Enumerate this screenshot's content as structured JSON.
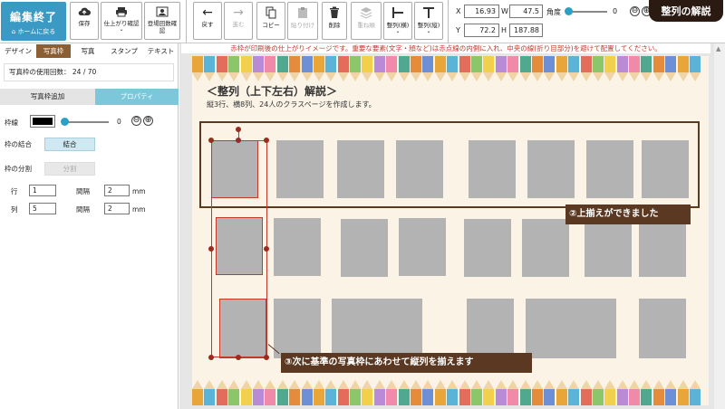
{
  "toolbar": {
    "finish_label": "編集終了",
    "home_label": "ホームに戻る",
    "buttons": {
      "save": "保存",
      "print_check": "仕上がり確認",
      "appearance_count": "登場回数確認",
      "back": "戻す",
      "forward": "進む",
      "copy": "コピー",
      "paste": "貼り付け",
      "delete": "削除",
      "order": "重ね順",
      "align_h": "整列(横)",
      "align_v": "整列(縦)"
    },
    "x_label": "X",
    "x_value": "16.93",
    "w_label": "W",
    "w_value": "47.5",
    "y_label": "Y",
    "y_value": "72.2",
    "h_label": "H",
    "h_value": "187.88",
    "angle_label": "角度",
    "angle_value": "0",
    "rotate_left": "⊖",
    "rotate_right": "⊕"
  },
  "title_tag": "整列の解説",
  "left_panel": {
    "tabs": [
      "デザイン",
      "写真枠",
      "写真",
      "スタンプ",
      "テキスト"
    ],
    "active_tab": 1,
    "count_label": "写真枠の使用回数：",
    "count_value": "24 / 70",
    "subtabs": [
      "写真枠追加",
      "プロパティ"
    ],
    "active_subtab": 1,
    "border_label": "枠線",
    "border_value": "0",
    "border_color": "#000000",
    "merge_label": "枠の結合",
    "merge_button": "結合",
    "split_label": "枠の分割",
    "split_button": "分割",
    "row_label": "行",
    "row_value": "1",
    "col_label": "列",
    "col_value": "5",
    "gap_label": "間隔",
    "gap_row_value": "2",
    "gap_col_value": "2",
    "unit": "mm"
  },
  "canvas": {
    "warning": "赤枠が印刷後の仕上がりイメージです。重要な要素(文字・顔など)は赤点線の内側に入れ、中央の線(折り目部分)を避けて配置してください。",
    "heading": "＜整列（上下左右）解説＞",
    "description": "縦3行、横8列、24人のクラスページを作成します。",
    "callout_top": "②上揃えができました",
    "callout_col": "③次に基準の写真枠にあわせて縦列を揃えます"
  },
  "colors": {
    "accent": "#3a9ac4",
    "tab_active": "#8b5e34",
    "subtab_active": "#7cc8da",
    "callout": "#5a3822",
    "selection": "#c0392b",
    "photo": "#b3b3b3",
    "page_bg": "#fbf4e6"
  }
}
